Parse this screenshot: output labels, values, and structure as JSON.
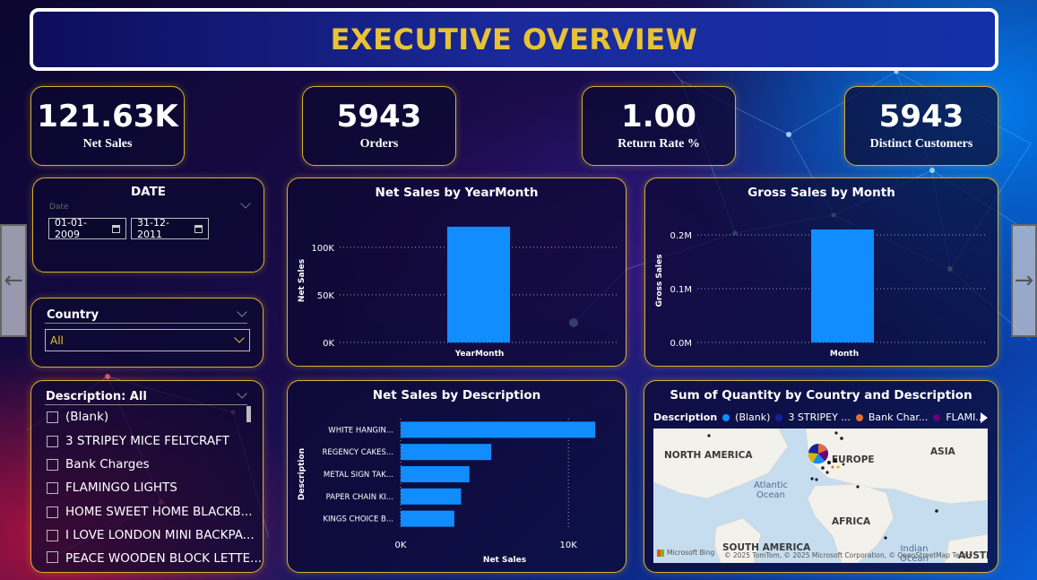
{
  "header": {
    "title": "EXECUTIVE OVERVIEW"
  },
  "kpis": [
    {
      "value": "121.63K",
      "label": "Net Sales"
    },
    {
      "value": "5943",
      "label": "Orders"
    },
    {
      "value": "1.00",
      "label": "Return Rate %"
    },
    {
      "value": "5943",
      "label": "Distinct Customers"
    }
  ],
  "date_slicer": {
    "title": "DATE",
    "field_hint": "Date",
    "start": "01-01-2009",
    "end": "31-12-2011"
  },
  "country_slicer": {
    "title": "Country",
    "selected": "All"
  },
  "description_slicer": {
    "title": "Description: All",
    "items": [
      "(Blank)",
      "3 STRIPEY MICE FELTCRAFT",
      "Bank Charges",
      "FLAMINGO LIGHTS",
      "HOME SWEET HOME BLACKB...",
      "I LOVE LONDON MINI BACKPA...",
      "PEACE WOODEN BLOCK LETTE..."
    ]
  },
  "charts": {
    "net_by_yearmonth": {
      "title": "Net Sales by YearMonth",
      "ylabel": "Net Sales",
      "xlabel": "YearMonth",
      "chart_data": {
        "type": "bar",
        "categories": [
          ""
        ],
        "values": [
          121630
        ],
        "ylim": [
          0,
          130000
        ],
        "yticks": [
          0,
          50000,
          100000
        ],
        "ytick_labels": [
          "0K",
          "50K",
          "100K"
        ]
      }
    },
    "gross_by_month": {
      "title": "Gross Sales by Month",
      "ylabel": "Gross Sales",
      "xlabel": "Month",
      "chart_data": {
        "type": "bar",
        "categories": [
          ""
        ],
        "values": [
          210000
        ],
        "ylim": [
          0,
          230000
        ],
        "yticks": [
          0,
          100000,
          200000
        ],
        "ytick_labels": [
          "0.0M",
          "0.1M",
          "0.2M"
        ]
      }
    },
    "net_by_description": {
      "title": "Net Sales by Description",
      "ylabel": "Description",
      "xlabel": "Net Sales",
      "chart_data": {
        "type": "bar",
        "orientation": "horizontal",
        "categories": [
          "WHITE HANGIN...",
          "REGENCY CAKES...",
          "METAL SIGN TAK...",
          "PAPER CHAIN KI...",
          "KINGS CHOICE B..."
        ],
        "values": [
          11600,
          5400,
          4100,
          3600,
          3200
        ],
        "xlim": [
          0,
          12500
        ],
        "xticks": [
          0,
          10000
        ],
        "xtick_labels": [
          "0K",
          "10K"
        ]
      }
    },
    "quantity_map": {
      "title": "Sum of Quantity by Country and Description",
      "legend_title": "Description",
      "legend": [
        {
          "name": "(Blank)",
          "color": "#118DFF"
        },
        {
          "name": "3 STRIPEY ...",
          "color": "#12239E"
        },
        {
          "name": "Bank Char...",
          "color": "#E66C37"
        },
        {
          "name": "FLAMI...",
          "color": "#6B007B"
        }
      ],
      "regions": [
        "NORTH AMERICA",
        "EUROPE",
        "ASIA",
        "AFRICA",
        "SOUTH AMERICA",
        "AUSTR"
      ],
      "oceans": [
        "Atlantic\nOcean",
        "Indian\nOcean"
      ],
      "attribution": "© 2025 TomTom, © 2025 Microsoft Corporation, © OpenStreetMap",
      "attribution_terms": "Terms",
      "bing_logo": "Microsoft Bing"
    }
  },
  "colors": {
    "accent": "#d7b02c",
    "bar": "#118DFF",
    "title": "#e8c234"
  }
}
